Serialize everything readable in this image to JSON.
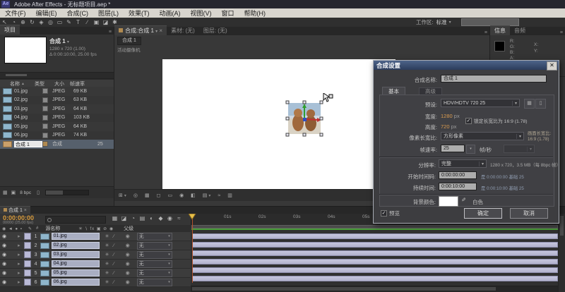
{
  "window": {
    "title": "Adobe After Effects - 无标题项目.aep *",
    "icon": "Ae"
  },
  "menubar": {
    "items": [
      "文件(F)",
      "编辑(E)",
      "合成(C)",
      "图层(L)",
      "效果(T)",
      "动画(A)",
      "视图(V)",
      "窗口",
      "帮助(H)"
    ]
  },
  "icons": {
    "caret": "▾",
    "caret_left": "◄",
    "sort_asc": "▲",
    "eye": "◉",
    "check": "✓",
    "menu": "≡",
    "close": "×",
    "trash": "▯",
    "save": "▦",
    "eyedropper": "✎",
    "delta": "Δ",
    "expand": "▸",
    "playhead": "▼"
  },
  "toolbar": {
    "tools": [
      {
        "name": "selection-tool",
        "glyph": "↖"
      },
      {
        "name": "hand-tool",
        "glyph": "◔"
      },
      {
        "name": "zoom-tool",
        "glyph": "⊕"
      },
      {
        "name": "rotation-tool",
        "glyph": "↻"
      },
      {
        "name": "camera-tool",
        "glyph": "◈"
      },
      {
        "name": "pan-behind-tool",
        "glyph": "◎"
      },
      {
        "name": "shape-tool",
        "glyph": "▭"
      },
      {
        "name": "pen-tool",
        "glyph": "✎"
      },
      {
        "name": "text-tool",
        "glyph": "T"
      },
      {
        "name": "brush-tool",
        "glyph": "∕"
      },
      {
        "name": "clone-stamp-tool",
        "glyph": "▣"
      },
      {
        "name": "eraser-tool",
        "glyph": "◪"
      },
      {
        "name": "puppet-pin-tool",
        "glyph": "✱"
      }
    ],
    "workspace_label": "工作区:",
    "workspace_value": "标准"
  },
  "project": {
    "tab": "项目",
    "preview": {
      "comp_name": "合成 1",
      "meta1": "1280 x 720 (1.00)",
      "meta2": "Δ 0:00:10:00, 25.00 fps"
    },
    "columns": {
      "name": "名称",
      "type": "类型",
      "size": "大小",
      "fps": "帧速率"
    },
    "files": [
      {
        "name": "01.jpg",
        "type": "JPEG",
        "size": "69 KB"
      },
      {
        "name": "02.jpg",
        "type": "JPEG",
        "size": "63 KB"
      },
      {
        "name": "03.jpg",
        "type": "JPEG",
        "size": "64 KB"
      },
      {
        "name": "04.jpg",
        "type": "JPEG",
        "size": "103 KB"
      },
      {
        "name": "05.jpg",
        "type": "JPEG",
        "size": "64 KB"
      },
      {
        "name": "06.jpg",
        "type": "JPEG",
        "size": "74 KB"
      },
      {
        "name": "合成 1",
        "type": "合成",
        "size": "",
        "fps": "25"
      }
    ],
    "footer_bpc": "8 bpc"
  },
  "viewer": {
    "tabs": [
      {
        "label": "合成:合成 1"
      },
      {
        "label": "素材: (无)"
      },
      {
        "label": "图层: (无)"
      }
    ],
    "subtab": "合成 1",
    "camera_label": "活动摄像机",
    "toolbar_icons": [
      {
        "name": "magnification-menu",
        "glyph": "⊞"
      },
      {
        "name": "safe-guides",
        "glyph": "◎"
      },
      {
        "name": "grid-options",
        "glyph": "▦"
      },
      {
        "name": "mask-visibility",
        "glyph": "◻"
      },
      {
        "name": "region-of-interest",
        "glyph": "▭"
      },
      {
        "name": "snapshot",
        "glyph": "◉"
      },
      {
        "name": "show-channel",
        "glyph": "◧"
      },
      {
        "name": "resolution-menu",
        "glyph": "▤"
      },
      {
        "name": "fast-preview",
        "glyph": "≈"
      },
      {
        "name": "timeline-button",
        "glyph": "▥"
      }
    ]
  },
  "info": {
    "tabs": [
      "信息",
      "音频"
    ],
    "channels": [
      "R:",
      "G:",
      "B:",
      "A:"
    ],
    "axes": [
      "X:",
      "Y:"
    ]
  },
  "dialog": {
    "title": "合成设置",
    "name_label": "合成名称:",
    "name_value": "合成 1",
    "tabs": [
      "基本",
      "高级"
    ],
    "preset_label": "预设:",
    "preset_value": "HDV/HDTV 720 25",
    "width_label": "宽度:",
    "width_value": "1280",
    "width_unit": "px",
    "lock_label": "锁定长宽比为 16:9 (1.78)",
    "height_label": "高度:",
    "height_value": "720",
    "height_unit": "px",
    "par_label": "像素长宽比:",
    "par_value": "方形像素",
    "far_label": "画面长宽比:",
    "far_value": "16:9 (1.78)",
    "fps_label": "帧速率:",
    "fps_value": "25",
    "fps_unit": "帧/秒",
    "res_label": "分辨率:",
    "res_value": "完整",
    "res_info": "1280 x 720，3.5 MB（每 8bpc 帧）",
    "start_label": "开始时间码:",
    "start_value": "0:00:00:00",
    "start_info": "是 0:00:00:00 基础 25",
    "dur_label": "持续时间:",
    "dur_value": "0:00:10:00",
    "dur_info": "是 0:00:10:00 基础 25",
    "bg_label": "背景颜色:",
    "bg_name": "白色",
    "preview_label": "预览",
    "ok_label": "确定",
    "cancel_label": "取消"
  },
  "timeline": {
    "tab": "合成 1",
    "timecode": "0:00:00:00",
    "timecode_sub": "00000 (25.00 fps)",
    "buttons": [
      {
        "name": "comp-flowchart",
        "glyph": "▦"
      },
      {
        "name": "draft-3d",
        "glyph": "◪"
      },
      {
        "name": "hide-shy-layers",
        "glyph": "◔"
      },
      {
        "name": "frame-blending",
        "glyph": "▤"
      },
      {
        "name": "motion-blur",
        "glyph": "◐"
      },
      {
        "name": "brainstorm",
        "glyph": "◆"
      },
      {
        "name": "auto-keyframe",
        "glyph": "◉"
      },
      {
        "name": "graph-editor",
        "glyph": "≈"
      }
    ],
    "av_glyphs": "◉ ◄ ● ▪",
    "label_glyph": "✎",
    "col_hash": "#",
    "col_source": "源名称",
    "switch_glyphs": "✳ ∖ fx ▣ ⊘ ◉",
    "col_parent": "父级",
    "row_switch_a": "✳",
    "row_switch_b": "∕",
    "row_switch_c": "◉",
    "parent_none": "无",
    "layers": [
      {
        "num": "1",
        "name": "01.jpg",
        "parent": "无"
      },
      {
        "num": "2",
        "name": "02.jpg",
        "parent": "无"
      },
      {
        "num": "3",
        "name": "03.jpg",
        "parent": "无"
      },
      {
        "num": "4",
        "name": "04.jpg",
        "parent": "无"
      },
      {
        "num": "5",
        "name": "05.jpg",
        "parent": "无"
      },
      {
        "num": "6",
        "name": "06.jpg",
        "parent": "无"
      }
    ],
    "ticks": [
      "01s",
      "02s",
      "03s",
      "04s",
      "05s"
    ]
  },
  "colors": {
    "accent_orange": "#d89a50",
    "layer_bar": "#bcbcd6",
    "render_green": "#4a9e3a",
    "playhead": "#e8c04a",
    "dialog_title_blue": "#3d5480"
  }
}
